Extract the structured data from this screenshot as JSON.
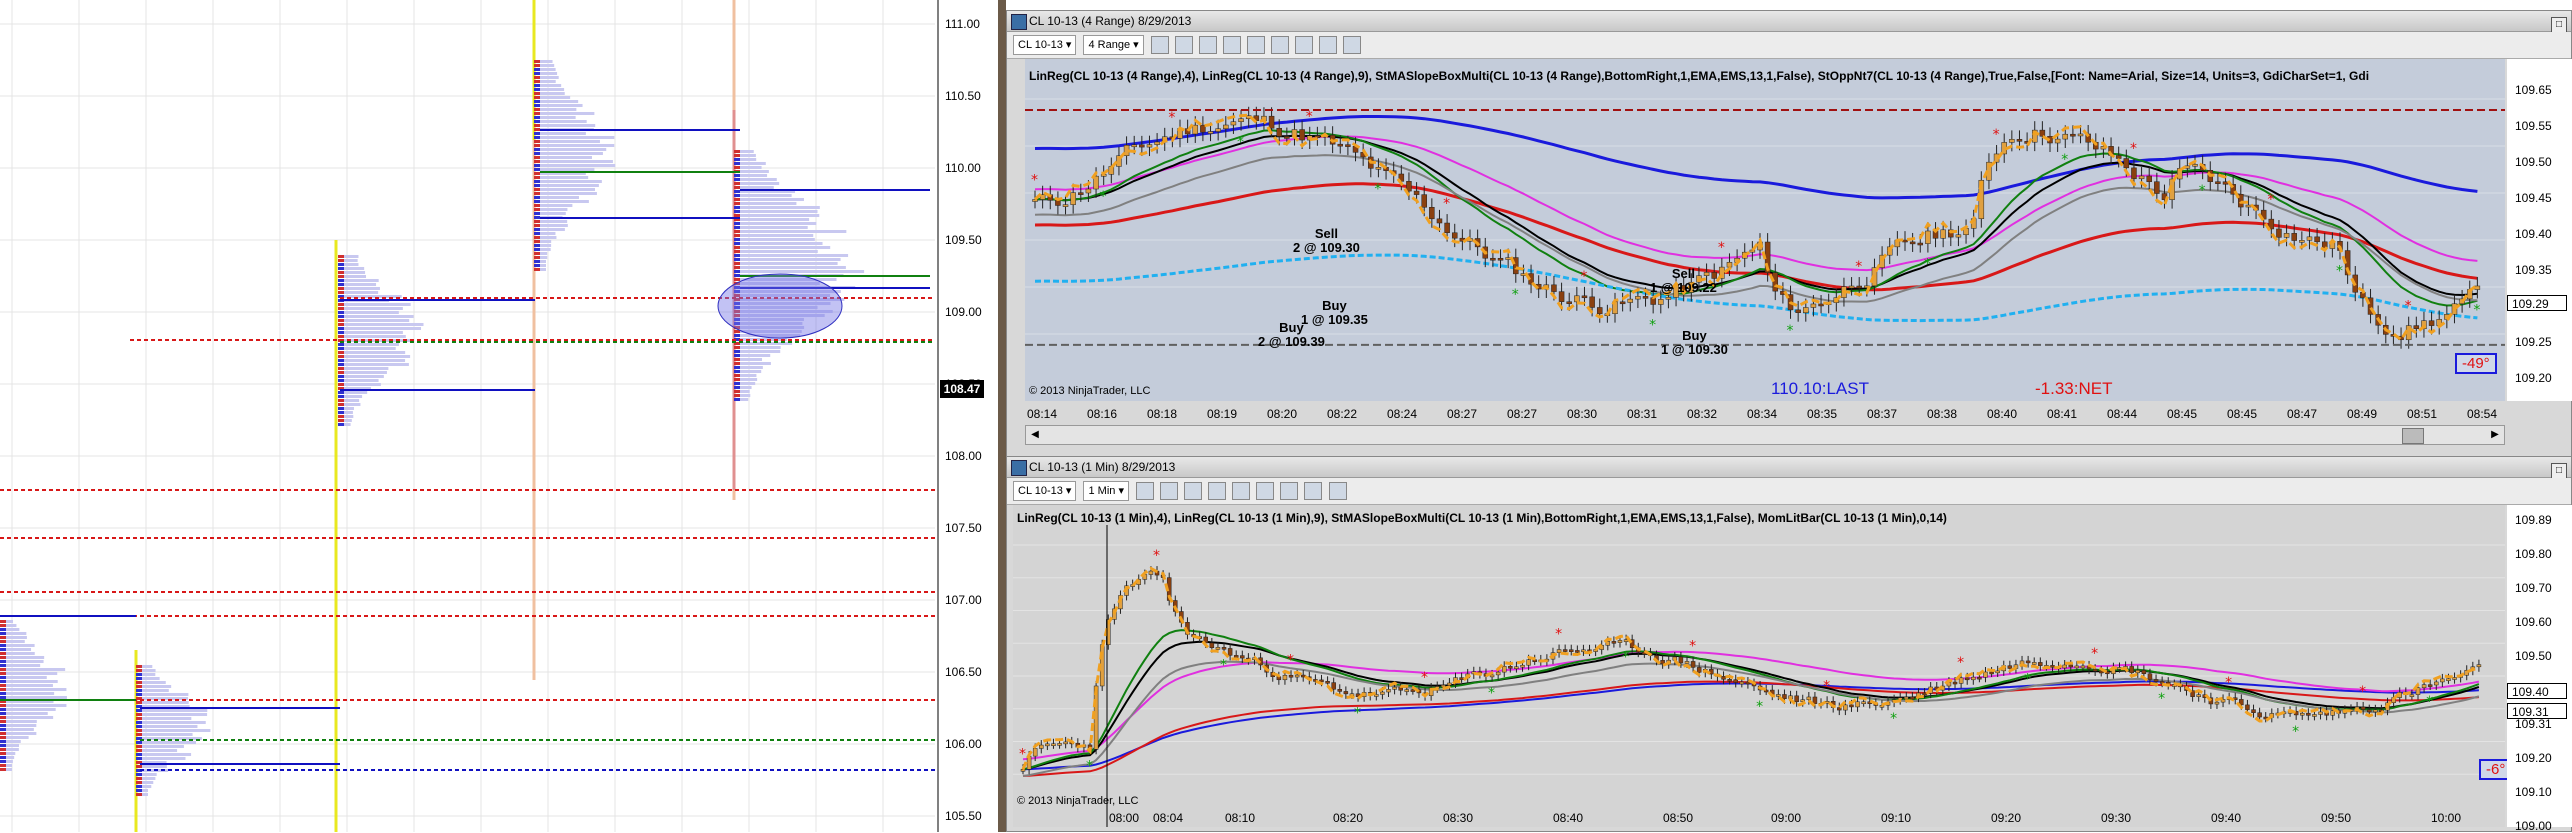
{
  "market_profile": {
    "price_axis": [
      "111.00",
      "110.50",
      "110.00",
      "109.50",
      "109.00",
      "108.50",
      "108.00",
      "107.50",
      "107.00",
      "106.50",
      "106.00",
      "105.50"
    ],
    "last_price": "108.47"
  },
  "top_chart": {
    "title": "CL 10-13 (4 Range)  8/29/2013",
    "instrument": "CL 10-13",
    "interval": "4 Range",
    "indicators": "LinReg(CL 10-13 (4 Range),4), LinReg(CL 10-13 (4 Range),9), StMASlopeBoxMulti(CL 10-13 (4 Range),BottomRight,1,EMA,EMS,13,1,False), StOppNt7(CL 10-13 (4 Range),True,False,[Font: Name=Arial, Size=14, Units=3, GdiCharSet=1, Gdi",
    "price_axis": [
      "109.65",
      "109.55",
      "109.50",
      "109.45",
      "109.40",
      "109.35",
      "109.30",
      "109.25",
      "109.20"
    ],
    "current_price": "109.29",
    "time_axis": [
      "08:14",
      "08:16",
      "08:18",
      "08:19",
      "08:20",
      "08:22",
      "08:24",
      "08:27",
      "08:27",
      "08:30",
      "08:31",
      "08:32",
      "08:34",
      "08:35",
      "08:37",
      "08:38",
      "08:40",
      "08:41",
      "08:44",
      "08:45",
      "08:45",
      "08:47",
      "08:49",
      "08:51",
      "08:54"
    ],
    "annotations": {
      "sell1": "Sell",
      "sell1_qty": "2 @ 109.30",
      "buy1": "Buy",
      "buy1_qty": "1 @ 109.35",
      "buy2": "Buy",
      "buy2_qty": "2 @ 109.39",
      "sell2": "Sell",
      "sell2_qty": "1 @ 109.22",
      "buy3": "Buy",
      "buy3_qty": "1 @ 109.30"
    },
    "last_label": "110.10:LAST",
    "net_label": "-1.33:NET",
    "slope_box": "-49°",
    "copyright": "© 2013 NinjaTrader, LLC"
  },
  "bottom_chart": {
    "title": "CL 10-13 (1 Min)  8/29/2013",
    "instrument": "CL 10-13",
    "interval": "1 Min",
    "indicators": "LinReg(CL 10-13 (1 Min),4), LinReg(CL 10-13 (1 Min),9), StMASlopeBoxMulti(CL 10-13 (1 Min),BottomRight,1,EMA,EMS,13,1,False), MomLitBar(CL 10-13 (1 Min),0,14)",
    "price_axis": [
      "109.89",
      "109.80",
      "109.70",
      "109.60",
      "109.50",
      "109.40",
      "109.31",
      "109.20",
      "109.10",
      "109.00"
    ],
    "current_price": "109.31",
    "upper_price": "109.40",
    "time_axis": [
      "08:00",
      "08:04",
      "08:10",
      "08:20",
      "08:30",
      "08:40",
      "08:50",
      "09:00",
      "09:10",
      "09:20",
      "09:30",
      "09:40",
      "09:50",
      "10:00"
    ],
    "slope_box": "-6°",
    "copyright": "© 2013 NinjaTrader, LLC"
  },
  "colors": {
    "plot_bg": "#c4ccda",
    "bottom_bg": "#d4d4d4",
    "ema_blue": "#1a1adc",
    "red_line": "#d81818",
    "magenta": "#e030e0",
    "cyan": "#20b0f0",
    "orange": "#f0a020"
  }
}
